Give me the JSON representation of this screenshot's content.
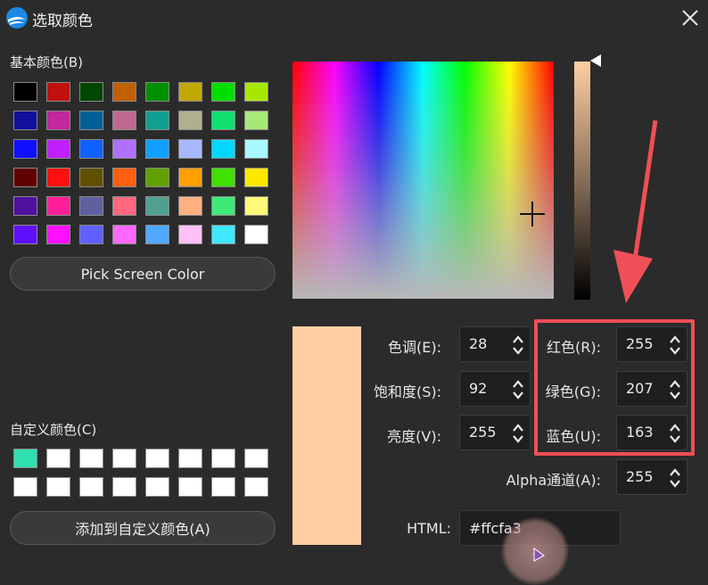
{
  "window": {
    "title": "选取颜色"
  },
  "basic_colors": {
    "label": "基本颜色(B)",
    "swatches": [
      "#000000",
      "#c01010",
      "#004800",
      "#c06000",
      "#009000",
      "#c0a800",
      "#00e000",
      "#a8e800",
      "#10109c",
      "#c0289c",
      "#006098",
      "#c06890",
      "#10a090",
      "#b0b090",
      "#10e070",
      "#a8e878",
      "#1010ff",
      "#c020ff",
      "#1060ff",
      "#b070ff",
      "#10a0ff",
      "#a8b8ff",
      "#00d8ff",
      "#a8f8ff",
      "#600000",
      "#ff1010",
      "#605000",
      "#ff6010",
      "#60a000",
      "#ffa000",
      "#40e000",
      "#ffe800",
      "#5010a0",
      "#ff2098",
      "#6060a0",
      "#ff6880",
      "#50a090",
      "#ffb080",
      "#40e878",
      "#fff878",
      "#6010ff",
      "#ff10ff",
      "#6060ff",
      "#ff68ff",
      "#50a8ff",
      "#ffc0f8",
      "#40e8ff",
      "#ffffff"
    ]
  },
  "pick_screen_button": "Pick Screen Color",
  "custom_colors": {
    "label": "自定义颜色(C)",
    "swatches": [
      "#30e0b0",
      "#ffffff",
      "#ffffff",
      "#ffffff",
      "#ffffff",
      "#ffffff",
      "#ffffff",
      "#ffffff",
      "#ffffff",
      "#ffffff",
      "#ffffff",
      "#ffffff",
      "#ffffff",
      "#ffffff",
      "#ffffff",
      "#ffffff"
    ]
  },
  "add_custom_button": "添加到自定义颜色(A)",
  "current_color": "#ffcfa3",
  "fields": {
    "hue": {
      "label": "色调(E):",
      "value": "28"
    },
    "saturation": {
      "label": "饱和度(S):",
      "value": "92"
    },
    "value": {
      "label": "亮度(V):",
      "value": "255"
    },
    "red": {
      "label": "红色(R):",
      "value": "255"
    },
    "green": {
      "label": "绿色(G):",
      "value": "207"
    },
    "blue": {
      "label": "蓝色(U):",
      "value": "163"
    },
    "alpha": {
      "label": "Alpha通道(A):",
      "value": "255"
    }
  },
  "html_field": {
    "label": "HTML:",
    "value": "#ffcfa3"
  },
  "annotation_color": "#ef4f56",
  "icons": {
    "close": "close-icon",
    "logo": "app-logo-icon",
    "spin": "spin-arrows-icon"
  }
}
